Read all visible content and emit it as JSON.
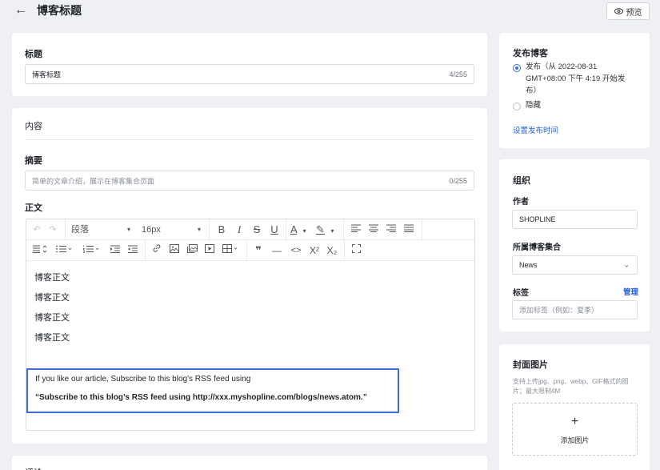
{
  "header": {
    "back_icon": "arrow-left-icon",
    "title": "博客标题",
    "preview_label": "预览",
    "preview_icon": "eye-icon"
  },
  "title_section": {
    "label": "标题",
    "value": "博客标题",
    "counter": "4/255"
  },
  "content_section": {
    "label": "内容",
    "summary_label": "摘要",
    "summary_placeholder": "简单的文章介绍，展示在博客集合页面",
    "summary_counter": "0/255",
    "body_label": "正文"
  },
  "editor": {
    "toolbar_row1": {
      "undo": "↶",
      "redo": "↷",
      "paragraph": "段落",
      "font_size": "16px",
      "bold": "B",
      "italic": "I",
      "strike": "S",
      "underline": "U",
      "font_color": "A",
      "highlight": "✎"
    },
    "toolbar_row2": {
      "quote": "❞",
      "hr": "—",
      "code": "<>",
      "superscript": "X²",
      "subscript": "X₂"
    },
    "body_lines": [
      "博客正文",
      "博客正文",
      "博客正文",
      "博客正文"
    ],
    "highlight_line1": "If you like our article, Subscribe to this blog's RSS feed using",
    "highlight_line2": "“Subscribe to this blog’s RSS feed using http://xxx.myshopline.com/blogs/news.atom.”"
  },
  "bottom_section_partial": "评论",
  "publish": {
    "title": "发布博客",
    "option_publish_line1": "发布（从 2022-08-31",
    "option_publish_line2": "GMT+08:00 下午 4:19 开始发",
    "option_publish_line3": "布）",
    "option_hide": "隐藏",
    "set_time_link": "设置发布时间",
    "selected": "publish"
  },
  "organization": {
    "title": "组织",
    "author_label": "作者",
    "author_value": "SHOPLINE",
    "collection_label": "所属博客集合",
    "collection_value": "News",
    "tags_label": "标签",
    "tags_manage": "管理",
    "tags_placeholder": "添加标签（例如：夏季）"
  },
  "cover": {
    "title": "封面图片",
    "hint_line1": "支持上传jpg、png、webp、GIF格式的图",
    "hint_line2": "片；最大限制4M",
    "upload_label": "添加图片"
  },
  "colors": {
    "accent": "#3b6fd8",
    "link": "#2a63d4",
    "background": "#eef0f3"
  }
}
